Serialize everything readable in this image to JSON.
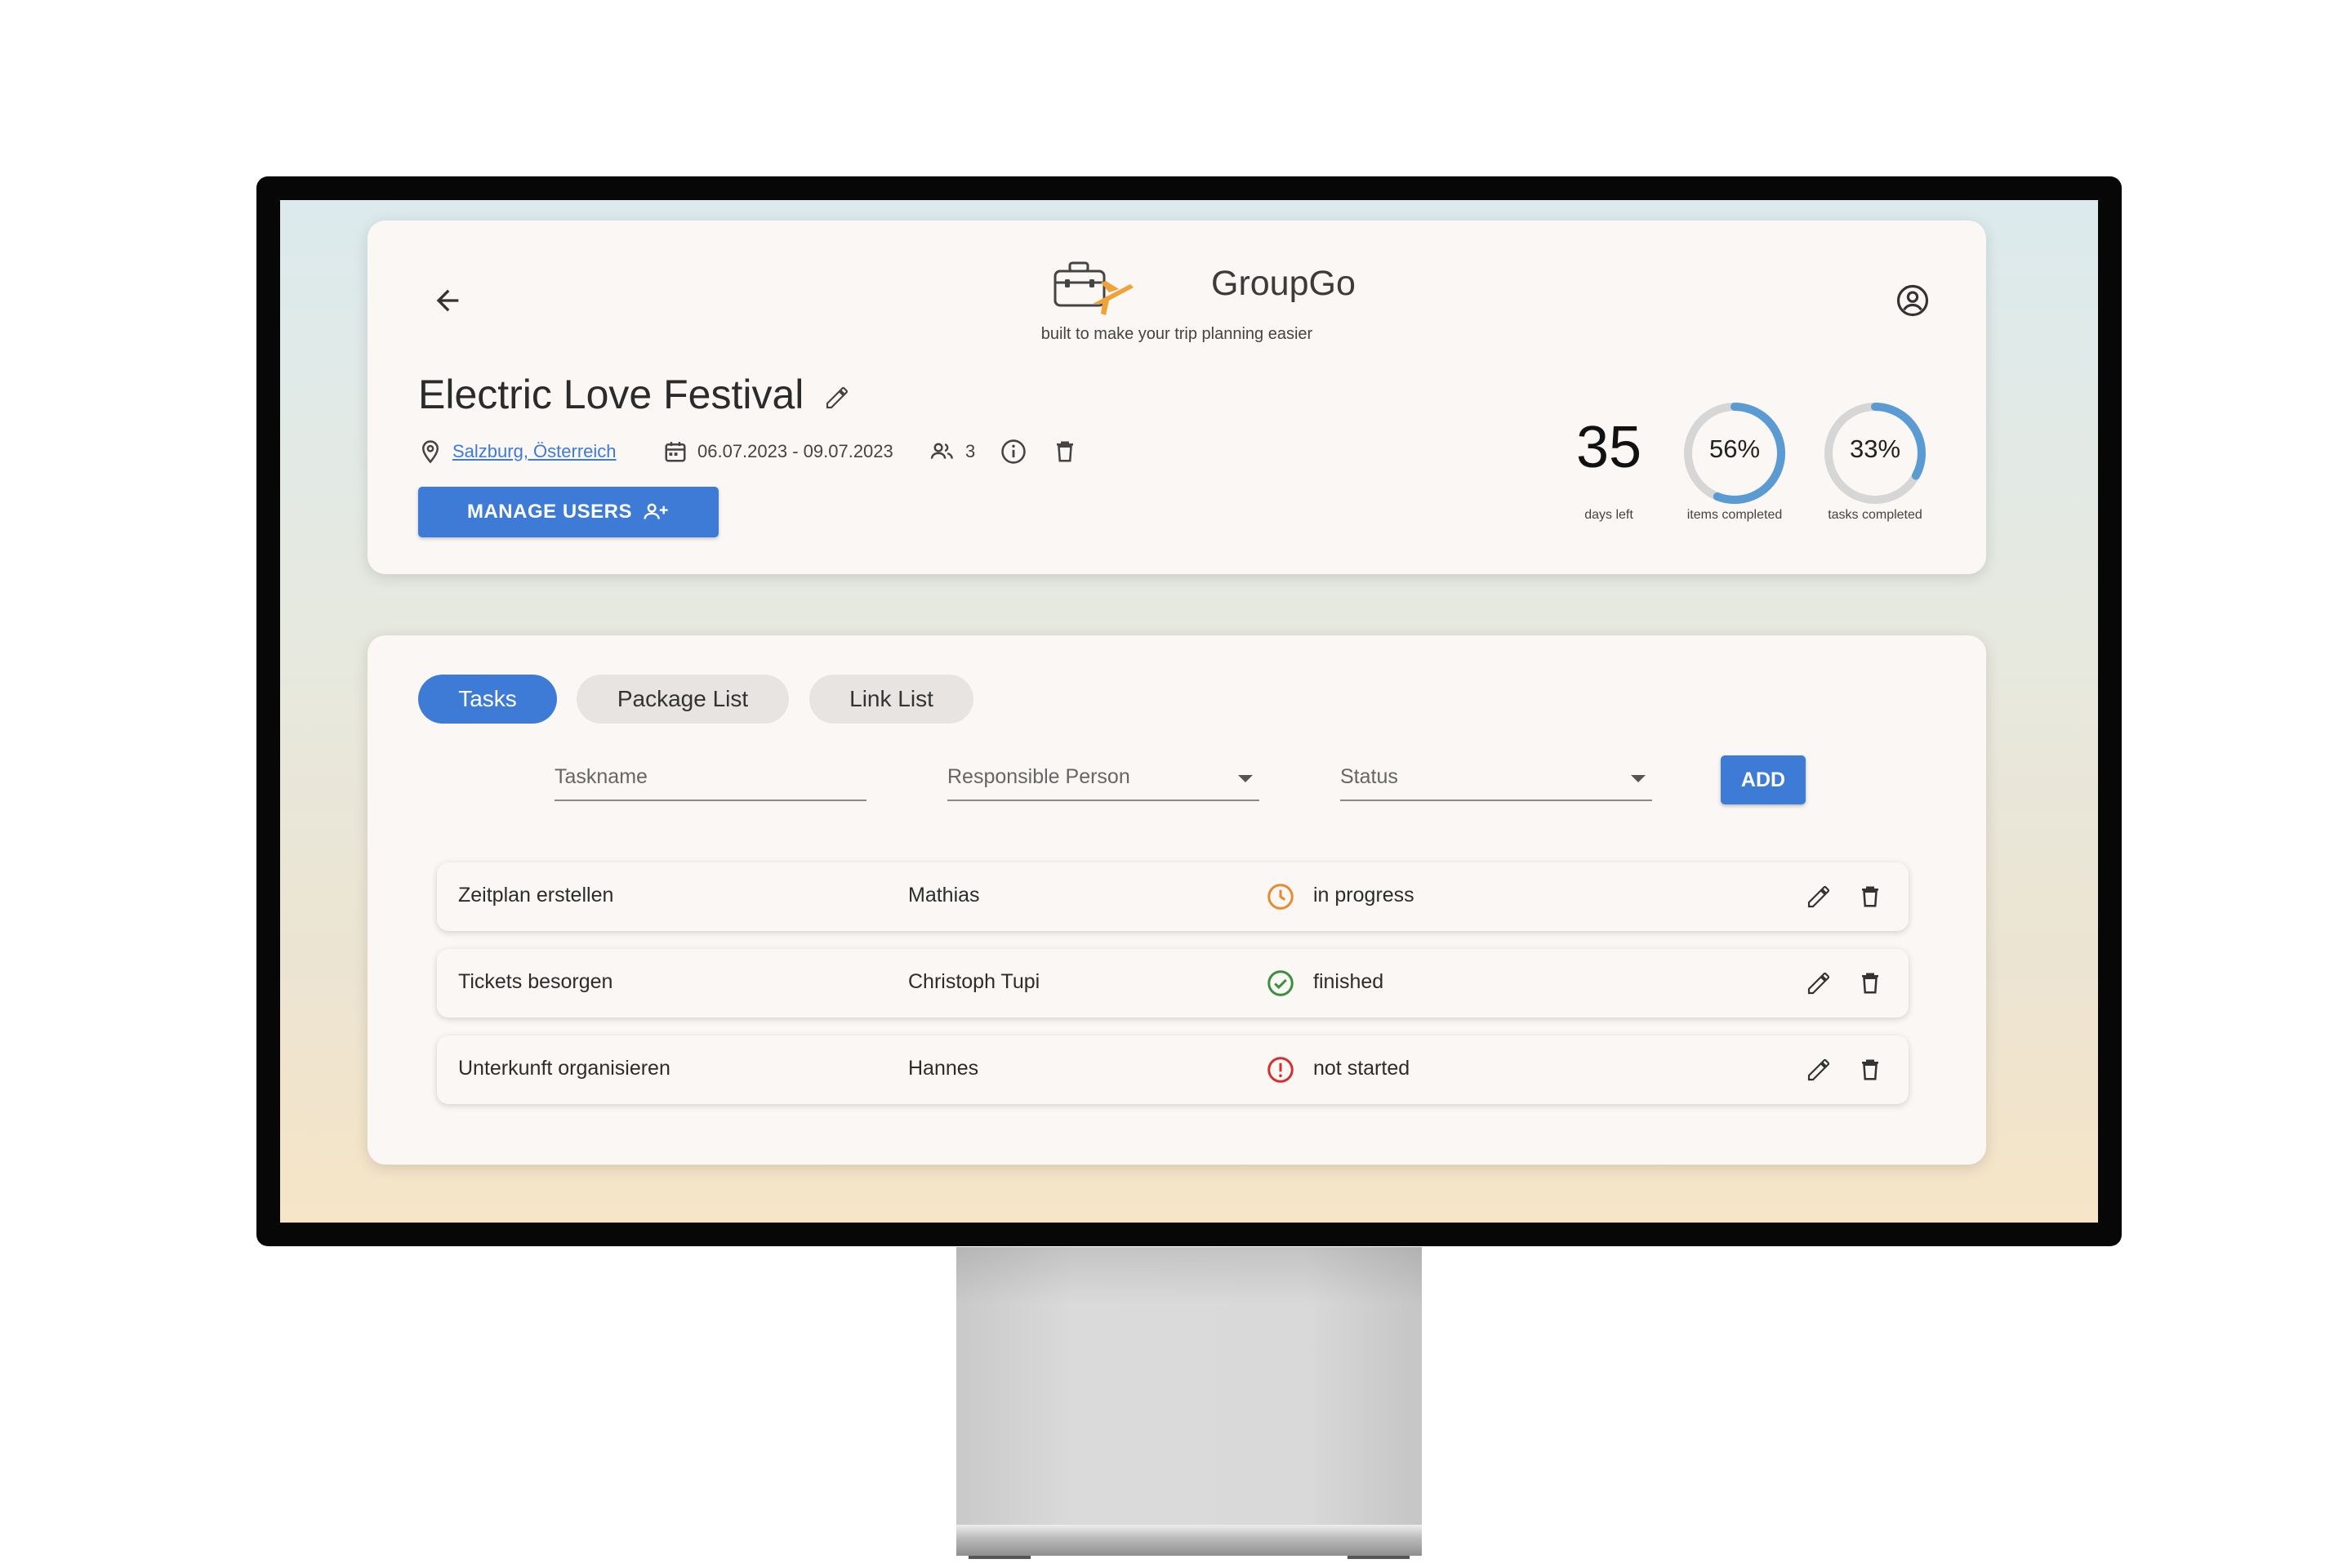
{
  "app": {
    "name": "GroupGo",
    "tagline": "built to make your trip planning easier"
  },
  "trip": {
    "title": "Electric Love Festival",
    "location": "Salzburg, Österreich",
    "dates": "06.07.2023 - 09.07.2023",
    "participants": "3",
    "manage_users_label": "MANAGE USERS"
  },
  "stats": {
    "days_left": "35",
    "days_left_label": "days left",
    "items_completed": "56%",
    "items_completed_fraction": 0.56,
    "items_completed_label": "items completed",
    "tasks_completed": "33%",
    "tasks_completed_fraction": 0.33,
    "tasks_completed_label": "tasks completed"
  },
  "tabs": [
    {
      "label": "Tasks",
      "active": true
    },
    {
      "label": "Package List",
      "active": false
    },
    {
      "label": "Link List",
      "active": false
    }
  ],
  "form": {
    "taskname_label": "Taskname",
    "responsible_label": "Responsible Person",
    "status_label": "Status",
    "add_label": "ADD"
  },
  "tasks": [
    {
      "name": "Zeitplan erstellen",
      "person": "Mathias",
      "status": "in progress",
      "status_icon": "clock-icon"
    },
    {
      "name": "Tickets besorgen",
      "person": "Christoph Tupi",
      "status": "finished",
      "status_icon": "check-circle-icon"
    },
    {
      "name": "Unterkunft organisieren",
      "person": "Hannes",
      "status": "not started",
      "status_icon": "alert-circle-icon"
    }
  ],
  "colors": {
    "primary": "#3e7bd6",
    "in_progress": "#e88a2e",
    "finished": "#3a8f3e",
    "not_started": "#d32f2f",
    "ring_track": "#d6d6d6",
    "ring_fill": "#5a9bd3"
  }
}
